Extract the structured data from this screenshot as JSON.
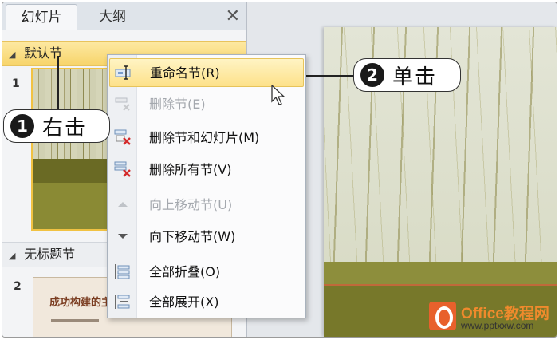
{
  "tabs": {
    "slides": "幻灯片",
    "outline": "大纲",
    "close": "✕"
  },
  "sections": {
    "default": "默认节",
    "untitled": "无标题节"
  },
  "slide_numbers": {
    "first": "1",
    "second": "2"
  },
  "thumb2_title": "成功构建的主",
  "callouts": {
    "one": {
      "badge": "1",
      "text": "右击"
    },
    "two": {
      "badge": "2",
      "text": "单击"
    }
  },
  "context_menu": {
    "items": [
      {
        "label": "重命名节(R)",
        "icon": "rename-icon",
        "highlighted": true,
        "disabled": false
      },
      {
        "label": "删除节(E)",
        "icon": "delete-section-icon",
        "highlighted": false,
        "disabled": true
      },
      {
        "label": "删除节和幻灯片(M)",
        "icon": "delete-section-slides-icon",
        "highlighted": false,
        "disabled": false
      },
      {
        "label": "删除所有节(V)",
        "icon": "delete-all-icon",
        "highlighted": false,
        "disabled": false
      },
      {
        "label": "向上移动节(U)",
        "icon": "move-up-icon",
        "highlighted": false,
        "disabled": true
      },
      {
        "label": "向下移动节(W)",
        "icon": "move-down-icon",
        "highlighted": false,
        "disabled": false
      },
      {
        "label": "全部折叠(O)",
        "icon": "collapse-all-icon",
        "highlighted": false,
        "disabled": false
      },
      {
        "label": "全部展开(X)",
        "icon": "expand-all-icon",
        "highlighted": false,
        "disabled": false
      }
    ]
  },
  "watermark": {
    "brand": "Office教程网",
    "url": "www.pptxxw.com"
  },
  "colors": {
    "accent": "#f7d46a",
    "highlight": "#fde18a",
    "delete_red": "#d42a2a"
  }
}
